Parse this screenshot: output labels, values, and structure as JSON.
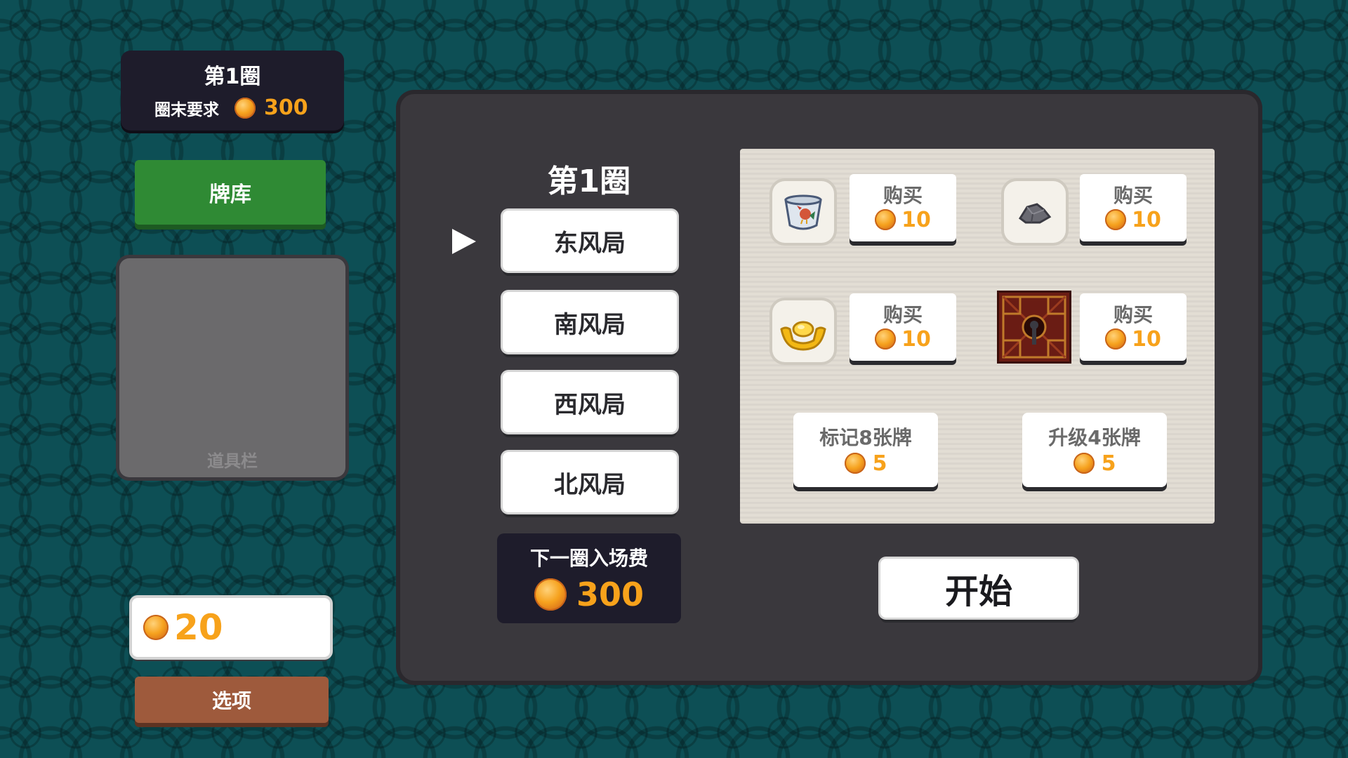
{
  "round_panel": {
    "title": "第1圈",
    "requirement_label": "圈末要求",
    "requirement_value": "300"
  },
  "deck_button": {
    "label": "牌库"
  },
  "item_bar": {
    "label": "道具栏"
  },
  "money": {
    "value": "20"
  },
  "options_button": {
    "label": "选项"
  },
  "main": {
    "round_title": "第1圈",
    "rounds": [
      {
        "label": "东风局",
        "selected": true
      },
      {
        "label": "南风局",
        "selected": false
      },
      {
        "label": "西风局",
        "selected": false
      },
      {
        "label": "北风局",
        "selected": false
      }
    ],
    "entry_fee_label": "下一圈入场费",
    "entry_fee_value": "300",
    "start_button": "开始"
  },
  "shop": {
    "items": [
      {
        "icon": "rooster-cup-icon",
        "buy_label": "购买",
        "price": "10"
      },
      {
        "icon": "stone-icon",
        "buy_label": "购买",
        "price": "10"
      },
      {
        "icon": "gold-ingot-icon",
        "buy_label": "购买",
        "price": "10"
      },
      {
        "icon": "lattice-lantern-icon",
        "buy_label": "购买",
        "price": "10"
      }
    ],
    "services": [
      {
        "label": "标记8张牌",
        "price": "5"
      },
      {
        "label": "升级4张牌",
        "price": "5"
      }
    ]
  },
  "colors": {
    "background": "#0d4f55",
    "panel": "#3a383d",
    "deck_green": "#2f8a34",
    "options_brown": "#9e5a3c",
    "coin_text": "#f7a21b",
    "shop_bg": "#e2ddd4"
  }
}
